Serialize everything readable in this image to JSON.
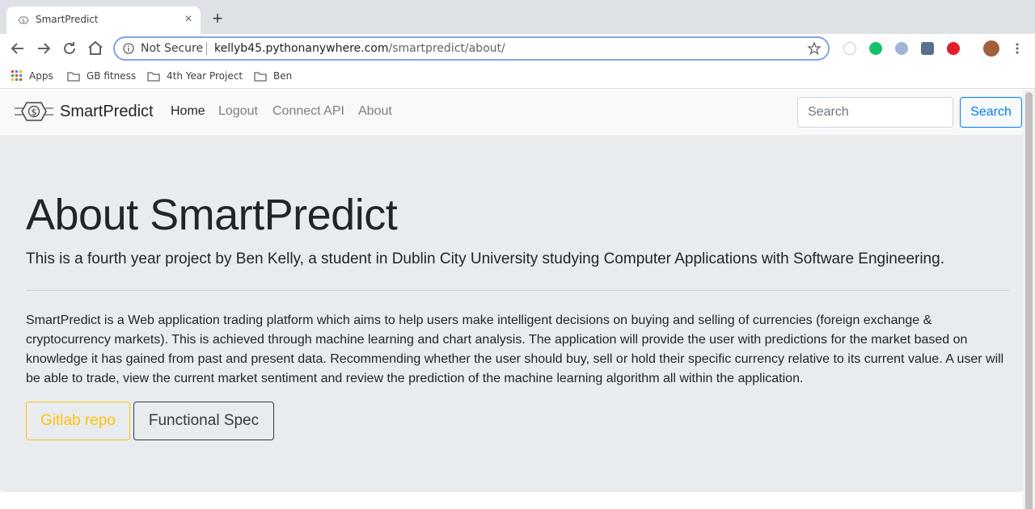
{
  "browser": {
    "tab_title": "SmartPredict",
    "tab_close": "×",
    "new_tab": "+",
    "security_label": "Not Secure",
    "url_host": "kellyb45.pythonanywhere.com",
    "url_path": "/smartpredict/about/",
    "bookmarks": [
      {
        "label": "Apps",
        "icon": "apps-grid-icon"
      },
      {
        "label": "GB fitness",
        "icon": "folder-icon"
      },
      {
        "label": "4th Year Project",
        "icon": "folder-icon"
      },
      {
        "label": "Ben",
        "icon": "folder-icon"
      }
    ],
    "accent_color": "#7fa5e2"
  },
  "navbar": {
    "brand": "SmartPredict",
    "links": [
      "Home",
      "Logout",
      "Connect API",
      "About"
    ],
    "active_link": "Home",
    "search_placeholder": "Search",
    "search_button": "Search"
  },
  "jumbotron": {
    "title": "About SmartPredict",
    "lead": "This is a fourth year project by Ben Kelly, a student in Dublin City University studying Computer Applications with Software Engineering.",
    "body": "SmartPredict is a Web application trading platform which aims to help users make intelligent decisions on buying and selling of currencies (foreign exchange & cryptocurrency markets). This is achieved through machine learning and chart analysis. The application will provide the user with predictions for the market based on knowledge it has gained from past and present data. Recommending whether the user should buy, sell or hold their specific currency relative to its current value. A user will be able to trade, view the current market sentiment and review the prediction of the machine learning algorithm all within the application.",
    "buttons": [
      {
        "label": "Gitlab repo",
        "color": "#ffc107"
      },
      {
        "label": "Functional Spec",
        "color": "#343a40"
      }
    ]
  }
}
